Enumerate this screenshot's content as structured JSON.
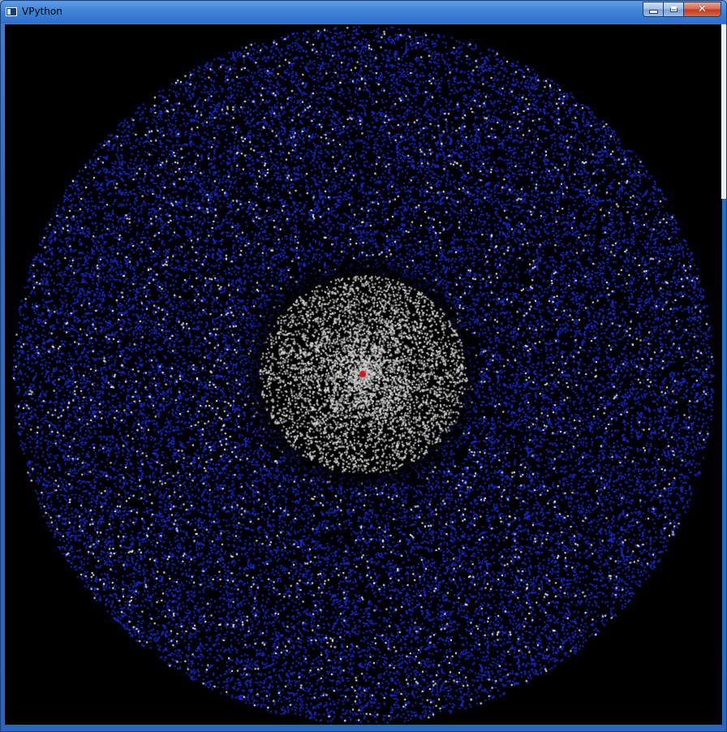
{
  "window": {
    "title": "VPython",
    "icon": "vpython-window-icon",
    "controls": {
      "minimize_icon": "minimize-icon",
      "maximize_icon": "maximize-icon",
      "close_label": "✕"
    }
  },
  "scene": {
    "background": "#000000",
    "outer_particle_color": "#1a2dd6",
    "inner_particle_color": "#d8d8d8",
    "highlight_particle_color": "#ffffff",
    "central_body_color": "#e01010"
  }
}
